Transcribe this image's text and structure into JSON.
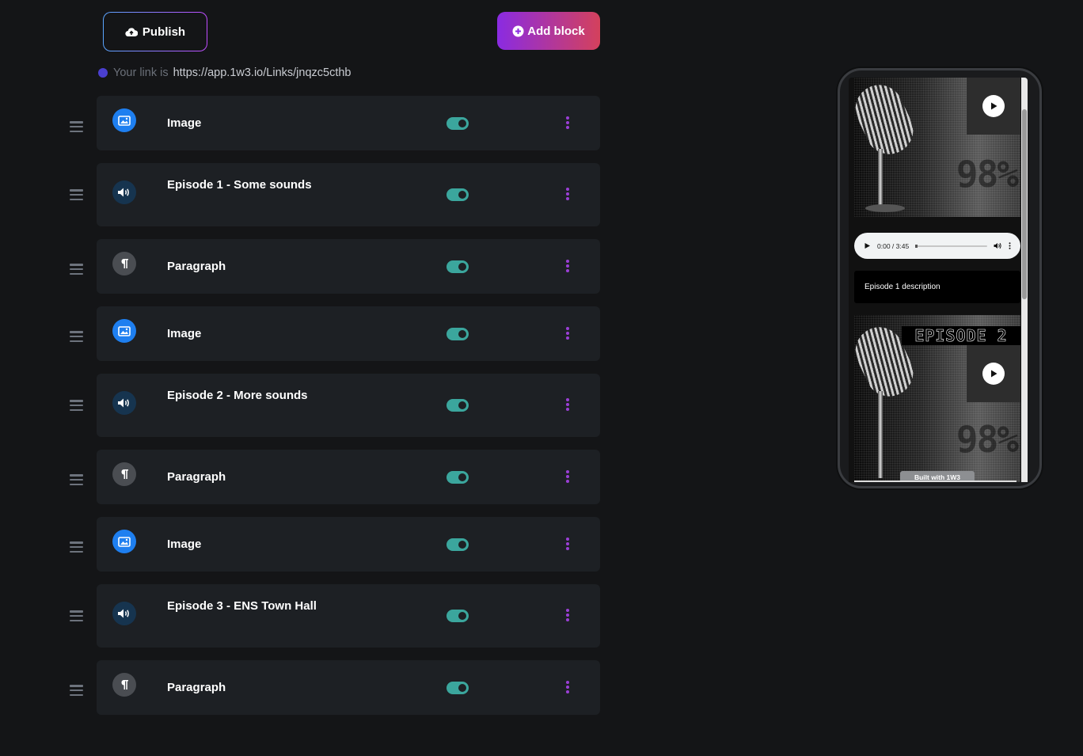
{
  "toolbar": {
    "publish_label": "Publish",
    "add_block_label": "Add block"
  },
  "link": {
    "prefix": "Your link is",
    "url": "https://app.1w3.io/Links/jnqzc5cthb"
  },
  "blocks": [
    {
      "type": "image",
      "title": "Image",
      "enabled": true
    },
    {
      "type": "audio",
      "title": "Episode 1 - Some sounds",
      "enabled": true
    },
    {
      "type": "paragraph",
      "title": "Paragraph",
      "enabled": true
    },
    {
      "type": "image",
      "title": "Image",
      "enabled": true
    },
    {
      "type": "audio",
      "title": "Episode 2 - More sounds",
      "enabled": true
    },
    {
      "type": "paragraph",
      "title": "Paragraph",
      "enabled": true
    },
    {
      "type": "image",
      "title": "Image",
      "enabled": true
    },
    {
      "type": "audio",
      "title": "Episode 3 - ENS Town Hall",
      "enabled": true
    },
    {
      "type": "paragraph",
      "title": "Paragraph",
      "enabled": true
    }
  ],
  "preview": {
    "audio_time": "0:00 / 3:45",
    "episode1_description": "Episode 1 description",
    "episode2_title": "EPISODE 2",
    "cover_percent": "98%",
    "built_with": "Built with 1W3"
  },
  "colors": {
    "toggle_on": "#3ba69d",
    "kebab": "#9b3fd6",
    "image_icon_bg": "#1e7ff0",
    "audio_icon_bg": "#16344f",
    "paragraph_icon_bg": "#4a4d52"
  },
  "icons": {
    "publish": "cloud-upload-icon",
    "add_block": "plus-circle-icon",
    "drag": "drag-handle-icon",
    "image": "image-icon",
    "audio": "volume-icon",
    "paragraph": "pilcrow-icon",
    "menu": "kebab-menu-icon"
  }
}
